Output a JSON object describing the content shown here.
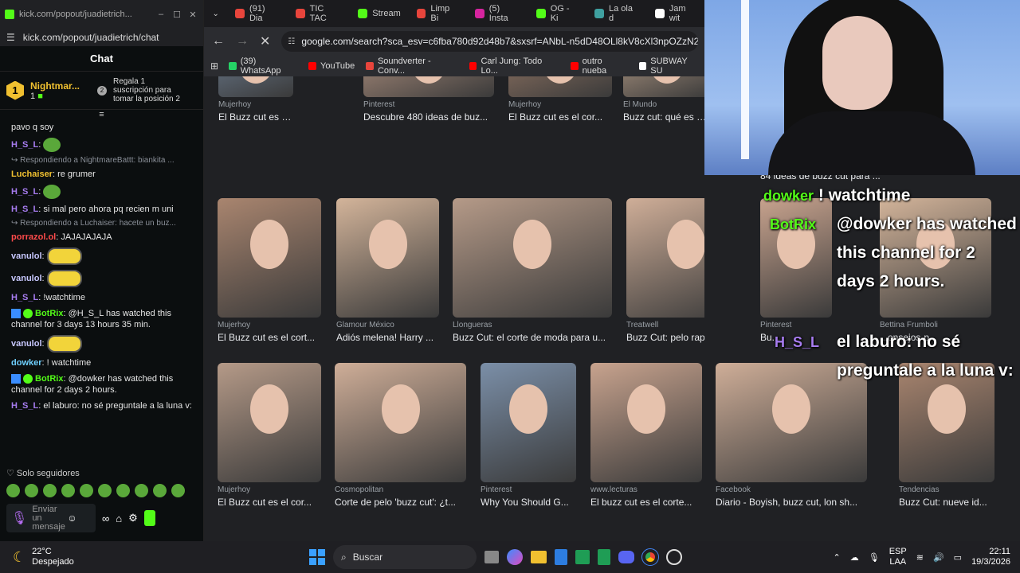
{
  "kick": {
    "window_title": "kick.com/popout/juadietrich...",
    "url": "kick.com/popout/juadietrich/chat",
    "chat_title": "Chat",
    "sub_user": "Nightmar...",
    "sub_count": "1",
    "sub_badge": "1",
    "gift_text": "Regala 1 suscripción para tomar la posición 2",
    "gift_badge": "2",
    "messages": [
      {
        "user": "",
        "text": "pavo q soy",
        "color": "#e6e6e6"
      },
      {
        "user": "H_S_L",
        "text": "",
        "color": "#a77cf0",
        "emote": "pepe"
      },
      {
        "reply": "Respondiendo a NightmareBattt: biankita ..."
      },
      {
        "user": "Luchaiser",
        "text": "re grumer",
        "color": "#f0c030"
      },
      {
        "user": "H_S_L",
        "text": "",
        "color": "#a77cf0",
        "emote": "pepe"
      },
      {
        "user": "H_S_L",
        "text": "si mal pero ahora pq recien m uni",
        "color": "#a77cf0"
      },
      {
        "reply": "Respondiendo a Luchaiser: hacete un buz..."
      },
      {
        "user": "porrazol.ol",
        "text": "JAJAJAJAJA",
        "color": "#ff4b4b"
      },
      {
        "user": "vanulol",
        "text": "",
        "color": "#c8c8ff",
        "emote": "minion"
      },
      {
        "user": "vanulol",
        "text": "",
        "color": "#c8c8ff",
        "emote": "minion"
      },
      {
        "user": "H_S_L",
        "text": "!watchtime",
        "color": "#a77cf0"
      },
      {
        "user": "BotRix",
        "text": "@H_S_L has watched this channel for 3 days 13 hours 35 min.",
        "color": "#53fc18",
        "bot": true
      },
      {
        "user": "vanulol",
        "text": "",
        "color": "#c8c8ff",
        "emote": "minion"
      },
      {
        "user": "dowker",
        "text": "! watchtime",
        "color": "#6fd0ff"
      },
      {
        "user": "BotRix",
        "text": "@dowker has watched this channel for 2 days 2 hours.",
        "color": "#53fc18",
        "bot": true
      },
      {
        "user": "H_S_L",
        "text": "el laburo: no sé preguntale a la luna v:",
        "color": "#a77cf0"
      }
    ],
    "followers_only": "Solo seguidores",
    "send_placeholder": "Enviar un mensaje"
  },
  "browser": {
    "tabs": [
      {
        "label": "(91) Dia",
        "color": "#e8453c"
      },
      {
        "label": "TIC TAC",
        "color": "#e8453c"
      },
      {
        "label": "Stream",
        "color": "#53fc18"
      },
      {
        "label": "Limp Bi",
        "color": "#e8453c"
      },
      {
        "label": "(5) Insta",
        "color": "#d6249f"
      },
      {
        "label": "OG - Ki",
        "color": "#53fc18"
      },
      {
        "label": "La ola d",
        "color": "#3fa0a0"
      },
      {
        "label": "Jam wit",
        "color": "#ffffff"
      }
    ],
    "url": "google.com/search?sca_esv=c6fba780d92d48b7&sxsrf=ANbL-n5dD48OLl8kV8cXl3npOZzN2Lfvy",
    "bookmarks": [
      {
        "label": "(39) WhatsApp",
        "color": "#25d366"
      },
      {
        "label": "YouTube",
        "color": "#ff0000"
      },
      {
        "label": "Soundverter - Conv...",
        "color": "#e8453c"
      },
      {
        "label": "Carl Jung: Todo Lo...",
        "color": "#ff0000"
      },
      {
        "label": "outro nueba",
        "color": "#ff0000"
      },
      {
        "label": "SUBWAY SU",
        "color": "#ffffff"
      }
    ],
    "row1": [
      {
        "src": "Mujerhoy",
        "title": "El Buzz cut es el corte de p..."
      },
      {
        "src": "Pinterest",
        "title": "Descubre 480 ideas de buz..."
      },
      {
        "src": "Mujerhoy",
        "title": "El Buzz cut es el cor..."
      },
      {
        "src": "El Mundo",
        "title": "Buzz cut: qué es y a qu..."
      }
    ],
    "row2": [
      {
        "src": "Mujerhoy",
        "title": "El Buzz cut es el cort..."
      },
      {
        "src": "Glamour México",
        "title": "Adiós melena! Harry ..."
      },
      {
        "src": "Llongueras",
        "title": "Buzz Cut: el corte de moda para u..."
      },
      {
        "src": "Treatwell",
        "title": "Buzz Cut: pelo rapado si..."
      }
    ],
    "row3": [
      {
        "src": "Mujerhoy",
        "title": "El Buzz cut es el cor..."
      },
      {
        "src": "Cosmopolitan",
        "title": "Corte de pelo 'buzz cut': ¿t..."
      },
      {
        "src": "Pinterest",
        "title": "Why You Should G..."
      },
      {
        "src": "www.lecturas",
        "title": "El buzz cut es el corte..."
      }
    ]
  },
  "overlay": {
    "lines": [
      {
        "user": "dowker",
        "text": "! watchtime",
        "color": "#53fc18"
      },
      {
        "user": "BotRix",
        "text": "@dowker has watched this channel for 2 days 2 hours.",
        "color": "#53fc18"
      },
      {
        "user": "H_S_L",
        "text": "el laburo: no sé preguntale a la luna v:",
        "color": "#a77cf0"
      }
    ],
    "right_cards": [
      {
        "src": "Pinterest",
        "title": "Bu..."
      },
      {
        "src": "Bettina Frumboli",
        "title": "...onsejos-p..."
      },
      {
        "src": "Facebook",
        "title": "Diario - Boyish, buzz cut, lon sh..."
      },
      {
        "src": "Tendencias",
        "title": "Buzz Cut: nueve id..."
      }
    ],
    "top_card_title": "84 ideas de buzz cut para ..."
  },
  "taskbar": {
    "weather_temp": "22°C",
    "weather_desc": "Despejado",
    "search_placeholder": "Buscar",
    "lang": "ESP",
    "lang2": "LAA",
    "time": "22:11",
    "date": "19/3/2026"
  }
}
